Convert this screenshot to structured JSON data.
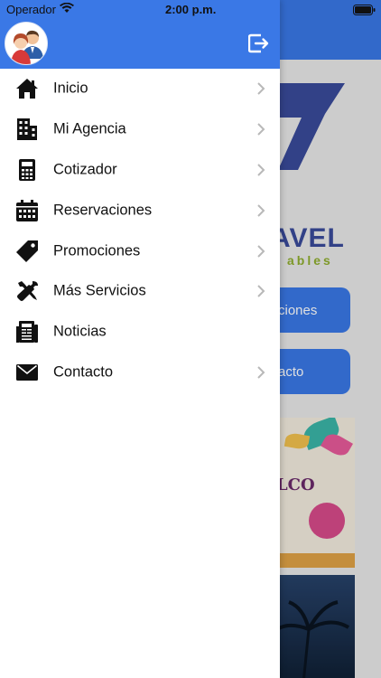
{
  "status_bar": {
    "carrier": "Operador",
    "time": "2:00 p.m."
  },
  "drawer": {
    "header": {
      "avatar_icon": "users-avatar-icon",
      "logout_icon": "logout-icon"
    },
    "menu": [
      {
        "label": "Inicio",
        "icon": "home-icon",
        "chevron": true
      },
      {
        "label": "Mi Agencia",
        "icon": "building-icon",
        "chevron": true
      },
      {
        "label": "Cotizador",
        "icon": "calculator-icon",
        "chevron": true
      },
      {
        "label": "Reservaciones",
        "icon": "calendar-icon",
        "chevron": true
      },
      {
        "label": "Promociones",
        "icon": "tag-icon",
        "chevron": true
      },
      {
        "label": "Más Servicios",
        "icon": "tools-icon",
        "chevron": true
      },
      {
        "label": "Noticias",
        "icon": "newspaper-icon",
        "chevron": false
      },
      {
        "label": "Contacto",
        "icon": "envelope-icon",
        "chevron": true
      }
    ]
  },
  "background": {
    "logo_text": "AVEL",
    "logo_sub": "ables",
    "button_1": "ciones",
    "button_2": "acto",
    "banner_title": "LCO"
  },
  "colors": {
    "primary": "#3a78e6",
    "text": "#111111",
    "chevron": "#b8b8b8"
  }
}
